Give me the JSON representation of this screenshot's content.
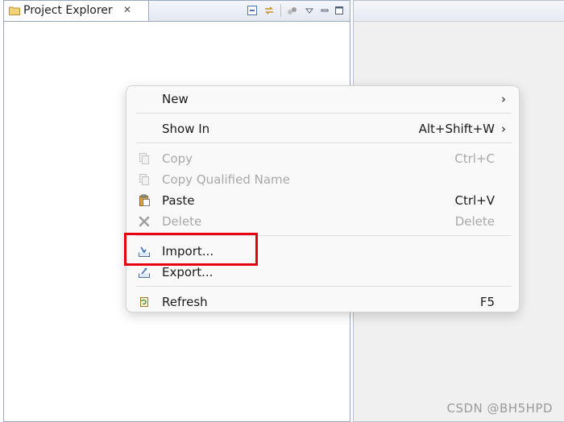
{
  "view": {
    "title": "Project Explorer",
    "close_symbol": "✕"
  },
  "menu": {
    "items": [
      {
        "label": "New",
        "shortcut": "",
        "arrow": "›",
        "icon": "none"
      },
      {
        "label": "Show In",
        "shortcut": "Alt+Shift+W",
        "arrow": "›",
        "icon": "none"
      },
      {
        "label": "Copy",
        "shortcut": "Ctrl+C",
        "arrow": "",
        "icon": "copy-icon",
        "disabled": true
      },
      {
        "label": "Copy Qualified Name",
        "shortcut": "",
        "arrow": "",
        "icon": "copy-qualified-name-icon",
        "disabled": true
      },
      {
        "label": "Paste",
        "shortcut": "Ctrl+V",
        "arrow": "",
        "icon": "paste-icon"
      },
      {
        "label": "Delete",
        "shortcut": "Delete",
        "arrow": "",
        "icon": "delete-icon",
        "disabled": true
      },
      {
        "label": "Import...",
        "shortcut": "",
        "arrow": "",
        "icon": "import-icon"
      },
      {
        "label": "Export...",
        "shortcut": "",
        "arrow": "",
        "icon": "export-icon"
      },
      {
        "label": "Refresh",
        "shortcut": "F5",
        "arrow": "",
        "icon": "refresh-icon"
      }
    ]
  },
  "colors": {
    "highlight": "#e60012",
    "disabled_text": "#a8a8a8"
  },
  "watermark": "CSDN @BH5HPD"
}
